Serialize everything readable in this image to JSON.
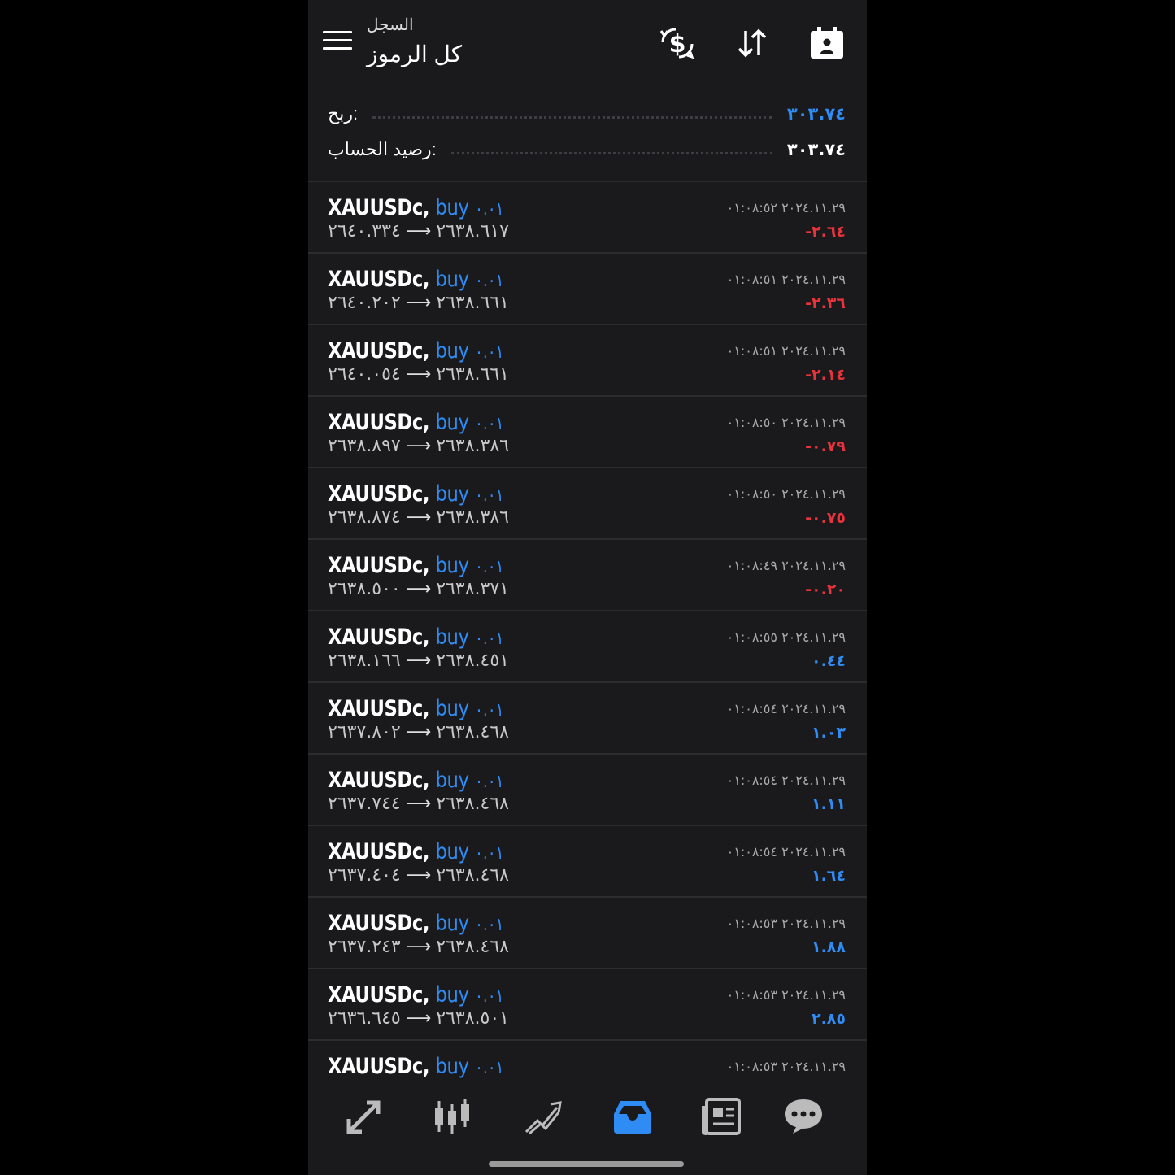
{
  "header": {
    "subtitle": "السجل",
    "title": "كل الرموز"
  },
  "summary": {
    "profit_label": "ربح:",
    "profit_value": "٣٠٣.٧٤",
    "balance_label": "رصيد الحساب:",
    "balance_value": "٣٠٣.٧٤"
  },
  "colors": {
    "accent": "#2f8cf5",
    "loss": "#e8323c",
    "background": "#1a1a1c"
  },
  "deals": [
    {
      "symbol": "XAUUSDc,",
      "type": "buy",
      "volume": "٠.٠١",
      "open": "٢٦٣٨.٦١٧",
      "close": "٢٦٤٠.٣٣٤",
      "time": "٢٠٢٤.١١.٢٩ ٠١:٠٨:٥٢",
      "profit": "-٢.٦٤",
      "profit_positive": false
    },
    {
      "symbol": "XAUUSDc,",
      "type": "buy",
      "volume": "٠.٠١",
      "open": "٢٦٣٨.٦٦١",
      "close": "٢٦٤٠.٢٠٢",
      "time": "٢٠٢٤.١١.٢٩ ٠١:٠٨:٥١",
      "profit": "-٢.٣٦",
      "profit_positive": false
    },
    {
      "symbol": "XAUUSDc,",
      "type": "buy",
      "volume": "٠.٠١",
      "open": "٢٦٣٨.٦٦١",
      "close": "٢٦٤٠.٠٥٤",
      "time": "٢٠٢٤.١١.٢٩ ٠١:٠٨:٥١",
      "profit": "-٢.١٤",
      "profit_positive": false
    },
    {
      "symbol": "XAUUSDc,",
      "type": "buy",
      "volume": "٠.٠١",
      "open": "٢٦٣٨.٣٨٦",
      "close": "٢٦٣٨.٨٩٧",
      "time": "٢٠٢٤.١١.٢٩ ٠١:٠٨:٥٠",
      "profit": "-٠.٧٩",
      "profit_positive": false
    },
    {
      "symbol": "XAUUSDc,",
      "type": "buy",
      "volume": "٠.٠١",
      "open": "٢٦٣٨.٣٨٦",
      "close": "٢٦٣٨.٨٧٤",
      "time": "٢٠٢٤.١١.٢٩ ٠١:٠٨:٥٠",
      "profit": "-٠.٧٥",
      "profit_positive": false
    },
    {
      "symbol": "XAUUSDc,",
      "type": "buy",
      "volume": "٠.٠١",
      "open": "٢٦٣٨.٣٧١",
      "close": "٢٦٣٨.٥٠٠",
      "time": "٢٠٢٤.١١.٢٩ ٠١:٠٨:٤٩",
      "profit": "-٠.٢٠",
      "profit_positive": false
    },
    {
      "symbol": "XAUUSDc,",
      "type": "buy",
      "volume": "٠.٠١",
      "open": "٢٦٣٨.٤٥١",
      "close": "٢٦٣٨.١٦٦",
      "time": "٢٠٢٤.١١.٢٩ ٠١:٠٨:٥٥",
      "profit": "٠.٤٤",
      "profit_positive": true
    },
    {
      "symbol": "XAUUSDc,",
      "type": "buy",
      "volume": "٠.٠١",
      "open": "٢٦٣٨.٤٦٨",
      "close": "٢٦٣٧.٨٠٢",
      "time": "٢٠٢٤.١١.٢٩ ٠١:٠٨:٥٤",
      "profit": "١.٠٣",
      "profit_positive": true
    },
    {
      "symbol": "XAUUSDc,",
      "type": "buy",
      "volume": "٠.٠١",
      "open": "٢٦٣٨.٤٦٨",
      "close": "٢٦٣٧.٧٤٤",
      "time": "٢٠٢٤.١١.٢٩ ٠١:٠٨:٥٤",
      "profit": "١.١١",
      "profit_positive": true
    },
    {
      "symbol": "XAUUSDc,",
      "type": "buy",
      "volume": "٠.٠١",
      "open": "٢٦٣٨.٤٦٨",
      "close": "٢٦٣٧.٤٠٤",
      "time": "٢٠٢٤.١١.٢٩ ٠١:٠٨:٥٤",
      "profit": "١.٦٤",
      "profit_positive": true
    },
    {
      "symbol": "XAUUSDc,",
      "type": "buy",
      "volume": "٠.٠١",
      "open": "٢٦٣٨.٤٦٨",
      "close": "٢٦٣٧.٢٤٣",
      "time": "٢٠٢٤.١١.٢٩ ٠١:٠٨:٥٣",
      "profit": "١.٨٨",
      "profit_positive": true
    },
    {
      "symbol": "XAUUSDc,",
      "type": "buy",
      "volume": "٠.٠١",
      "open": "٢٦٣٨.٥٠١",
      "close": "٢٦٣٦.٦٤٥",
      "time": "٢٠٢٤.١١.٢٩ ٠١:٠٨:٥٣",
      "profit": "٢.٨٥",
      "profit_positive": true
    },
    {
      "symbol": "XAUUSDc,",
      "type": "buy",
      "volume": "٠.٠١",
      "open": "",
      "close": "",
      "time": "٢٠٢٤.١١.٢٩ ٠١:٠٨:٥٣",
      "profit": "",
      "profit_positive": true
    }
  ],
  "bottom_nav": [
    {
      "name": "nav-quotes",
      "icon": "quotes-arrows-icon",
      "active": false
    },
    {
      "name": "nav-chart",
      "icon": "candlestick-icon",
      "active": false
    },
    {
      "name": "nav-trade",
      "icon": "trend-lines-icon",
      "active": false
    },
    {
      "name": "nav-history",
      "icon": "inbox-tray-icon",
      "active": true
    },
    {
      "name": "nav-news",
      "icon": "newspaper-icon",
      "active": false
    },
    {
      "name": "nav-messages",
      "icon": "chat-bubble-icon",
      "active": false
    }
  ]
}
